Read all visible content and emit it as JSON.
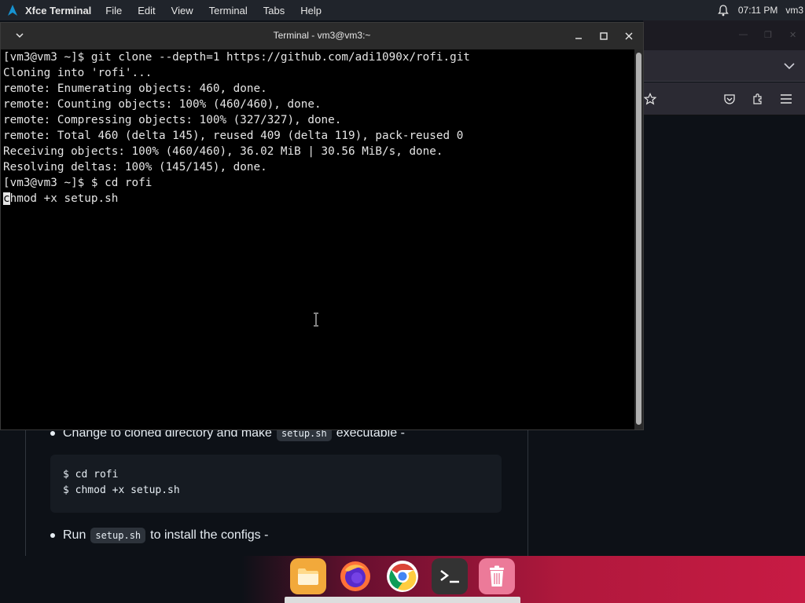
{
  "top_panel": {
    "app_name": "Xfce Terminal",
    "menu": [
      "File",
      "Edit",
      "View",
      "Terminal",
      "Tabs",
      "Help"
    ],
    "clock": "07:11 PM",
    "user": "vm3"
  },
  "terminal": {
    "title": "Terminal - vm3@vm3:~",
    "lines": [
      "[vm3@vm3 ~]$ git clone --depth=1 https://github.com/adi1090x/rofi.git",
      "Cloning into 'rofi'...",
      "remote: Enumerating objects: 460, done.",
      "remote: Counting objects: 100% (460/460), done.",
      "remote: Compressing objects: 100% (327/327), done.",
      "remote: Total 460 (delta 145), reused 409 (delta 119), pack-reused 0",
      "Receiving objects: 100% (460/460), 36.02 MiB | 30.56 MiB/s, done.",
      "Resolving deltas: 100% (145/145), done.",
      "[vm3@vm3 ~]$ $ cd rofi"
    ],
    "input_cursor_char": "c",
    "input_rest": "hmod +x setup.sh"
  },
  "page": {
    "bullet1_before": "Change to cloned directory and make",
    "bullet1_code": "setup.sh",
    "bullet1_after": "executable -",
    "code_lines": [
      "$ cd rofi",
      "$ chmod +x setup.sh"
    ],
    "bullet2_before": "Run",
    "bullet2_code": "setup.sh",
    "bullet2_after": "to install the configs -"
  },
  "dock": {
    "items": [
      {
        "name": "files",
        "color": "#f5a623"
      },
      {
        "name": "firefox",
        "color": "#3b2a7a"
      },
      {
        "name": "chrome",
        "color": "#ffffff"
      },
      {
        "name": "terminal",
        "color": "#2d2d2d"
      },
      {
        "name": "trash",
        "color": "#e86a8a"
      }
    ]
  },
  "colors": {
    "terminal_bg": "#000000",
    "terminal_fg": "#e5e5e5",
    "page_bg": "#0d1117"
  }
}
